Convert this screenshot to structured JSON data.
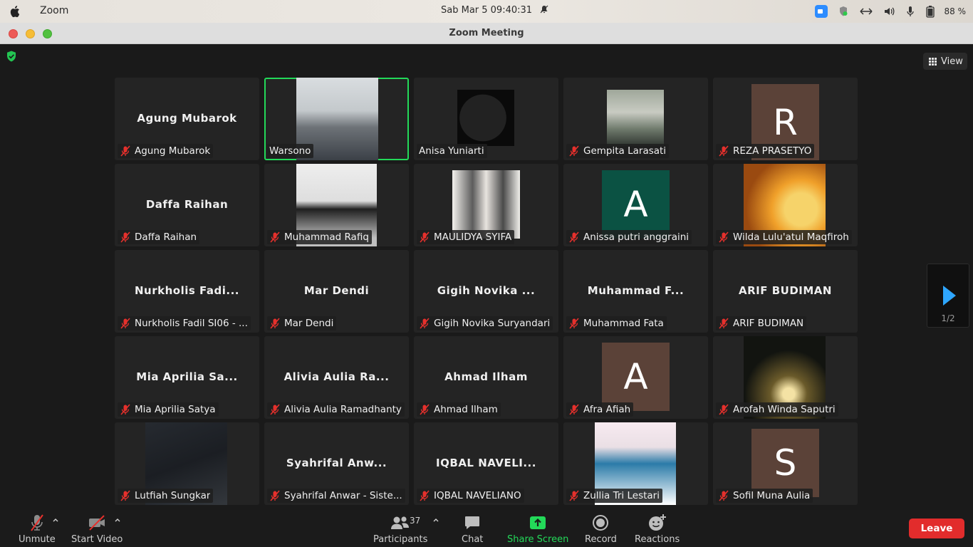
{
  "menubar": {
    "app_name": "Zoom",
    "clock": "Sab Mar 5  09:40:31",
    "battery": "88 %",
    "icons": [
      "apple-icon",
      "bell-icon",
      "zoom-icon",
      "shield-icon",
      "network-icon",
      "volume-icon",
      "microphone-icon",
      "battery-icon"
    ]
  },
  "window": {
    "title": "Zoom Meeting"
  },
  "meeting": {
    "view_label": "View",
    "page_indicator": "1/2",
    "tiles": [
      {
        "title": "Agung Mubarok",
        "label": "Agung Mubarok",
        "kind": "name",
        "muted": true
      },
      {
        "title": "",
        "label": "Warsono",
        "kind": "video",
        "muted": false,
        "active": true
      },
      {
        "title": "",
        "label": "Anisa Yuniarti",
        "kind": "video",
        "muted": false
      },
      {
        "title": "",
        "label": "Gempita Larasati",
        "kind": "video",
        "muted": true
      },
      {
        "title": "",
        "label": "REZA PRASETYO",
        "kind": "avatar",
        "avatar_letter": "R",
        "avatar_color": "#5b4238",
        "muted": true
      },
      {
        "title": "Daffa Raihan",
        "label": "Daffa Raihan",
        "kind": "name",
        "muted": true
      },
      {
        "title": "",
        "label": "Muhammad Rafiq",
        "kind": "video",
        "muted": true
      },
      {
        "title": "",
        "label": "MAULIDYA SYIFA",
        "kind": "video",
        "muted": true
      },
      {
        "title": "",
        "label": "Anissa putri anggraini",
        "kind": "avatar",
        "avatar_letter": "A",
        "avatar_color": "#0b5243",
        "muted": true
      },
      {
        "title": "",
        "label": "Wilda Lulu'atul Maqfiroh",
        "kind": "video",
        "muted": true
      },
      {
        "title": "Nurkholis Fadi...",
        "label": "Nurkholis Fadil SI06 - ...",
        "kind": "name",
        "muted": true
      },
      {
        "title": "Mar Dendi",
        "label": "Mar Dendi",
        "kind": "name",
        "muted": true
      },
      {
        "title": "Gigih Novika ...",
        "label": "Gigih Novika Suryandari",
        "kind": "name",
        "muted": true
      },
      {
        "title": "Muhammad F...",
        "label": "Muhammad Fata",
        "kind": "name",
        "muted": true
      },
      {
        "title": "ARIF BUDIMAN",
        "label": "ARIF BUDIMAN",
        "kind": "name",
        "muted": true
      },
      {
        "title": "Mia Aprilia Sa...",
        "label": "Mia Aprilia Satya",
        "kind": "name",
        "muted": true
      },
      {
        "title": "Alivia Aulia Ra...",
        "label": "Alivia Aulia Ramadhanty",
        "kind": "name",
        "muted": true
      },
      {
        "title": "Ahmad Ilham",
        "label": "Ahmad Ilham",
        "kind": "name",
        "muted": true
      },
      {
        "title": "",
        "label": "Afra Afiah",
        "kind": "avatar",
        "avatar_letter": "A",
        "avatar_color": "#5b4238",
        "muted": true
      },
      {
        "title": "",
        "label": "Arofah Winda Saputri",
        "kind": "video",
        "muted": true
      },
      {
        "title": "",
        "label": "Lutfiah Sungkar",
        "kind": "video",
        "muted": true
      },
      {
        "title": "Syahrifal Anw...",
        "label": "Syahrifal Anwar - Siste...",
        "kind": "name",
        "muted": true
      },
      {
        "title": "IQBAL NAVELI...",
        "label": "IQBAL NAVELIANO",
        "kind": "name",
        "muted": true
      },
      {
        "title": "",
        "label": "Zullia Tri Lestari",
        "kind": "video",
        "muted": true
      },
      {
        "title": "",
        "label": "Sofil Muna Aulia",
        "kind": "avatar",
        "avatar_letter": "S",
        "avatar_color": "#5b4238",
        "muted": true
      }
    ]
  },
  "toolbar": {
    "unmute": "Unmute",
    "start_video": "Start Video",
    "participants": "Participants",
    "participant_count": "37",
    "chat": "Chat",
    "share_screen": "Share Screen",
    "record": "Record",
    "reactions": "Reactions",
    "leave": "Leave",
    "colors": {
      "share_green": "#23d959",
      "leave_red": "#e22c2c",
      "active_border": "#23d959",
      "next_arrow": "#2ea6ff"
    }
  }
}
